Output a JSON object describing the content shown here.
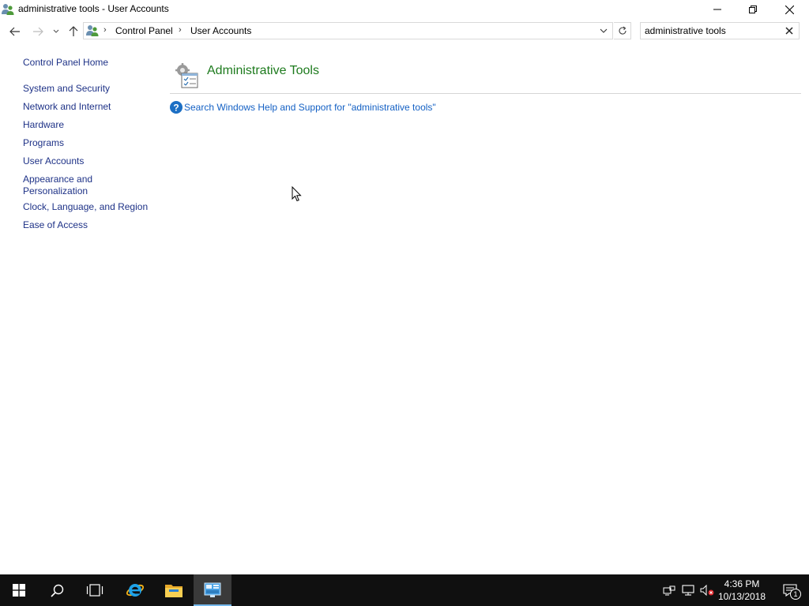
{
  "window": {
    "title": "administrative tools - User Accounts"
  },
  "address": {
    "crumbs": [
      "Control Panel",
      "User Accounts"
    ],
    "separator": "›"
  },
  "search": {
    "value": "administrative tools"
  },
  "sidebar": {
    "home": "Control Panel Home",
    "items": [
      {
        "label": "System and Security"
      },
      {
        "label": "Network and Internet"
      },
      {
        "label": "Hardware"
      },
      {
        "label": "Programs"
      },
      {
        "label": "User Accounts"
      },
      {
        "label": "Appearance and\nPersonalization"
      },
      {
        "label": "Clock, Language, and Region"
      },
      {
        "label": "Ease of Access"
      }
    ]
  },
  "results": {
    "title": "Administrative Tools",
    "help_link": "Search Windows Help and Support for \"administrative tools\""
  },
  "taskbar": {
    "time": "4:36 PM",
    "date": "10/13/2018",
    "notification_count": "1"
  },
  "colors": {
    "link": "#1e3287",
    "result_title": "#1e7b1e",
    "help_link": "#1360c4",
    "taskbar": "#101010",
    "taskbar_accent": "#76b9ed"
  },
  "icons": {
    "app": "user-accounts-icon",
    "result": "administrative-tools-icon",
    "help": "help-icon"
  }
}
